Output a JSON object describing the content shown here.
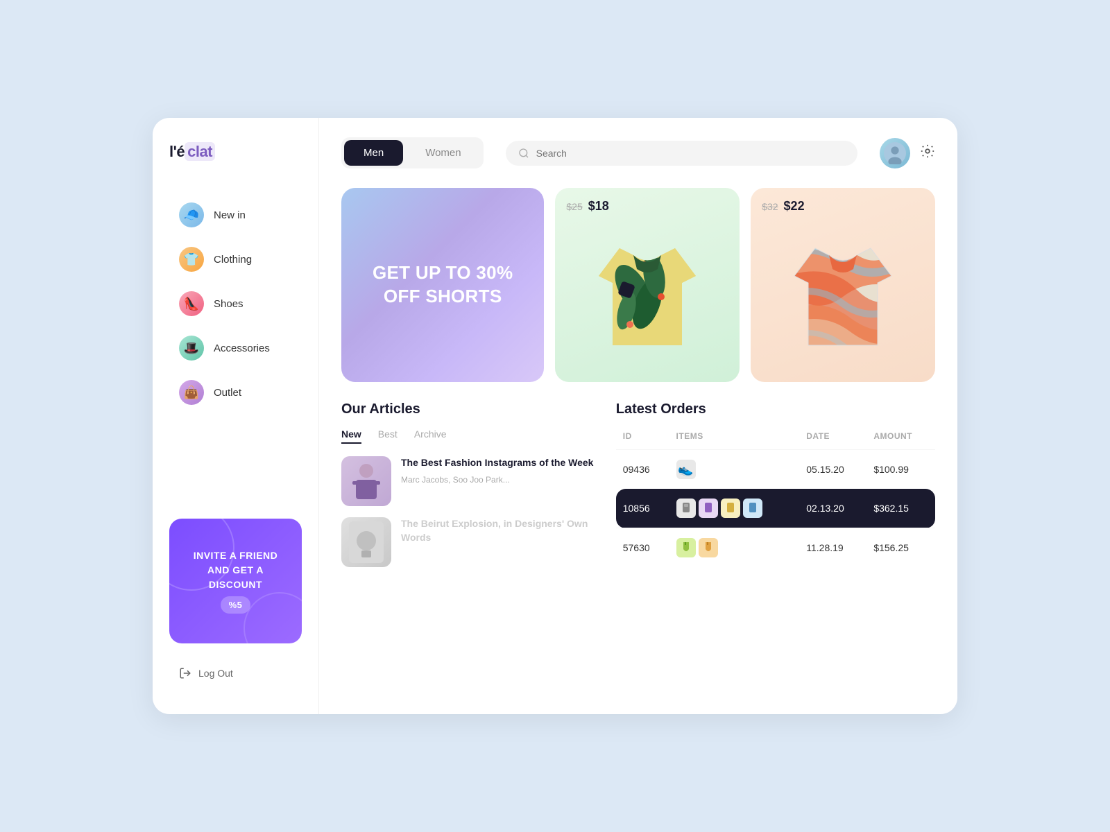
{
  "app": {
    "logo_prefix": "l'é",
    "logo_highlight": "clat"
  },
  "sidebar": {
    "nav_items": [
      {
        "id": "new-in",
        "label": "New in",
        "icon": "🧢",
        "icon_class": "blue"
      },
      {
        "id": "clothing",
        "label": "Clothing",
        "icon": "👕",
        "icon_class": "orange"
      },
      {
        "id": "shoes",
        "label": "Shoes",
        "icon": "👠",
        "icon_class": "pink"
      },
      {
        "id": "accessories",
        "label": "Accessories",
        "icon": "🎩",
        "icon_class": "teal"
      },
      {
        "id": "outlet",
        "label": "Outlet",
        "icon": "👜",
        "icon_class": "purple"
      }
    ],
    "promo": {
      "line1": "INVITE A FRIEND",
      "line2": "AND GET A",
      "line3": "DISCOUNT",
      "badge": "%5"
    },
    "logout_label": "Log Out"
  },
  "header": {
    "tabs": [
      {
        "id": "men",
        "label": "Men",
        "active": true
      },
      {
        "id": "women",
        "label": "Women",
        "active": false
      }
    ],
    "search_placeholder": "Search"
  },
  "hero": {
    "banner_text": "GET UP TO 30% OFF SHORTS",
    "products": [
      {
        "id": "product-1",
        "price_old": "$25",
        "price_new": "$18",
        "style": "green",
        "emoji": "🌺"
      },
      {
        "id": "product-2",
        "price_old": "$32",
        "price_new": "$22",
        "style": "peach",
        "emoji": "🌿"
      }
    ]
  },
  "articles": {
    "heading": "Our Articles",
    "tabs": [
      {
        "id": "new",
        "label": "New",
        "active": true
      },
      {
        "id": "best",
        "label": "Best",
        "active": false
      },
      {
        "id": "archive",
        "label": "Archive",
        "active": false
      }
    ],
    "items": [
      {
        "id": "article-1",
        "title": "The Best Fashion Instagrams of the Week",
        "description": "Marc Jacobs, Soo Joo Park...",
        "thumb_style": "fashion",
        "faded": false
      },
      {
        "id": "article-2",
        "title": "The Beirut Explosion, in Designers' Own Words",
        "description": "",
        "thumb_style": "explosion",
        "faded": true
      }
    ]
  },
  "orders": {
    "heading": "Latest Orders",
    "columns": [
      "ID",
      "ITEMS",
      "DATE",
      "AMOUNT"
    ],
    "rows": [
      {
        "id": "09436",
        "date": "05.15.20",
        "amount": "$100.99",
        "highlighted": false,
        "items_type": "shoes"
      },
      {
        "id": "10856",
        "date": "02.13.20",
        "amount": "$362.15",
        "highlighted": true,
        "items_type": "clothes"
      },
      {
        "id": "57630",
        "date": "11.28.19",
        "amount": "$156.25",
        "highlighted": false,
        "items_type": "dresses"
      }
    ]
  }
}
